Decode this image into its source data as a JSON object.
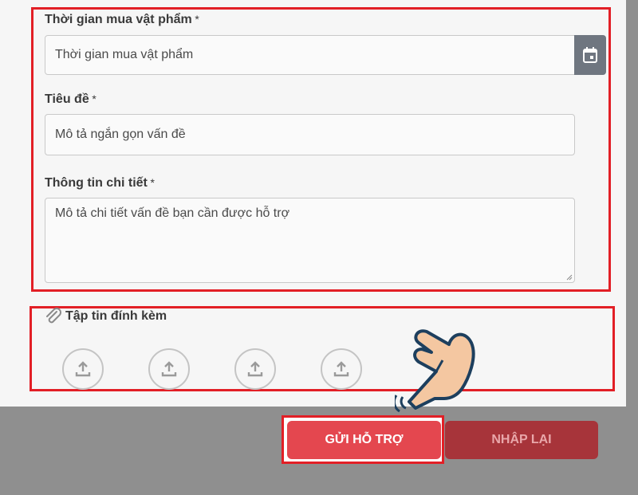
{
  "form": {
    "purchase_time": {
      "label": "Thời gian mua vật phẩm",
      "required_mark": "*",
      "placeholder": "Thời gian mua vật phẩm"
    },
    "title": {
      "label": "Tiêu đề",
      "required_mark": "*",
      "placeholder": "Mô tả ngắn gọn vấn đề"
    },
    "details": {
      "label": "Thông tin chi tiết",
      "required_mark": "*",
      "placeholder": "Mô tả chi tiết vấn đề bạn cần được hỗ trợ"
    }
  },
  "attachments": {
    "label": "Tập tin đính kèm",
    "upload_slots": 4
  },
  "actions": {
    "send_label": "GỬI HỖ TRỢ",
    "reset_label": "NHẬP LẠI"
  },
  "colors": {
    "highlight": "#e21f26",
    "send_button": "#e4474f",
    "reset_button": "#a7343a"
  },
  "icons": {
    "calendar": "calendar-icon",
    "paperclip": "paperclip-icon",
    "upload": "upload-icon",
    "pointer": "hand-pointer-icon"
  }
}
